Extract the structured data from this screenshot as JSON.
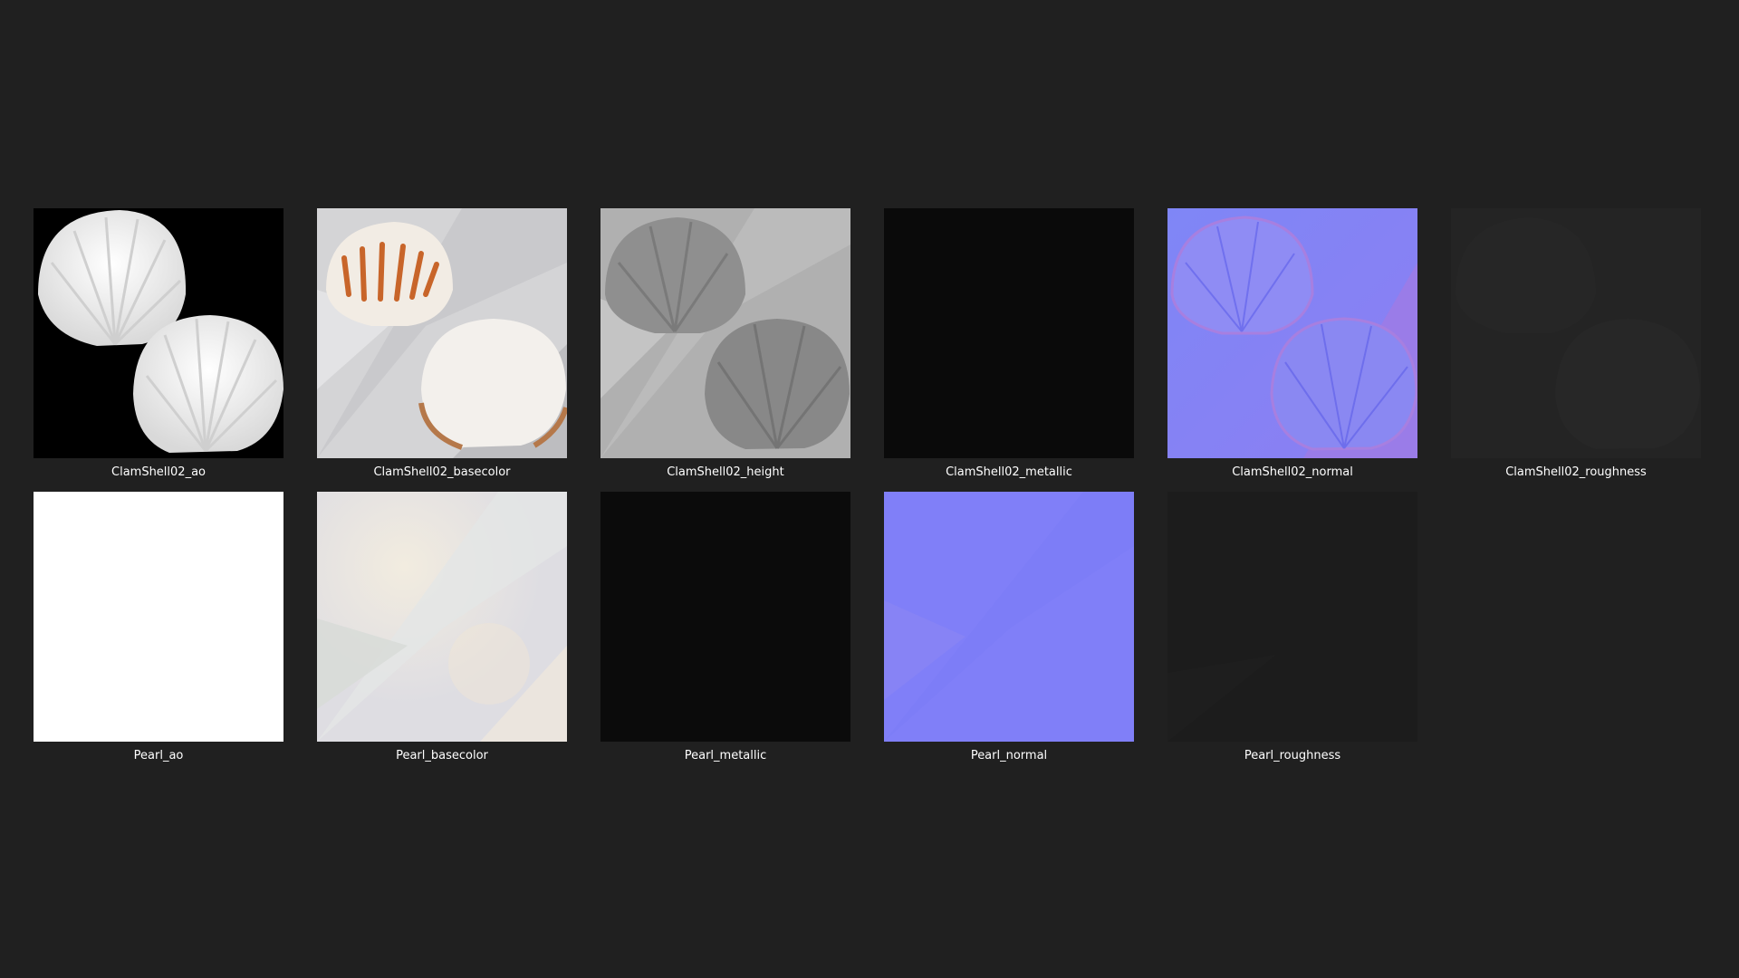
{
  "files": [
    {
      "name": "ClamShell02_ao",
      "thumbnail": "ambient-occlusion-map",
      "colors": {
        "bg": "#000000",
        "fg": "#f2f2f2"
      }
    },
    {
      "name": "ClamShell02_basecolor",
      "thumbnail": "base-color-map",
      "colors": {
        "bg": "#d4d4d6",
        "accent": "#c8652a"
      }
    },
    {
      "name": "ClamShell02_height",
      "thumbnail": "height-map",
      "colors": {
        "bg": "#b0b0b0",
        "fg": "#8c8c8c"
      }
    },
    {
      "name": "ClamShell02_metallic",
      "thumbnail": "metallic-map",
      "colors": {
        "bg": "#0a0a0a"
      }
    },
    {
      "name": "ClamShell02_normal",
      "thumbnail": "normal-map",
      "colors": {
        "bg": "#8080f4",
        "fg": "#9b7be8"
      }
    },
    {
      "name": "ClamShell02_roughness",
      "thumbnail": "roughness-map",
      "colors": {
        "bg": "#242424"
      }
    },
    {
      "name": "Pearl_ao",
      "thumbnail": "ambient-occlusion-map",
      "colors": {
        "bg": "#ffffff"
      }
    },
    {
      "name": "Pearl_basecolor",
      "thumbnail": "base-color-map",
      "colors": {
        "bg": "#e6e4e4"
      }
    },
    {
      "name": "Pearl_metallic",
      "thumbnail": "metallic-map",
      "colors": {
        "bg": "#0b0b0b"
      }
    },
    {
      "name": "Pearl_normal",
      "thumbnail": "normal-map",
      "colors": {
        "bg": "#807ff8"
      }
    },
    {
      "name": "Pearl_roughness",
      "thumbnail": "roughness-map",
      "colors": {
        "bg": "#1c1c1c"
      }
    }
  ],
  "theme": {
    "background": "#202020",
    "text": "#ffffff"
  }
}
